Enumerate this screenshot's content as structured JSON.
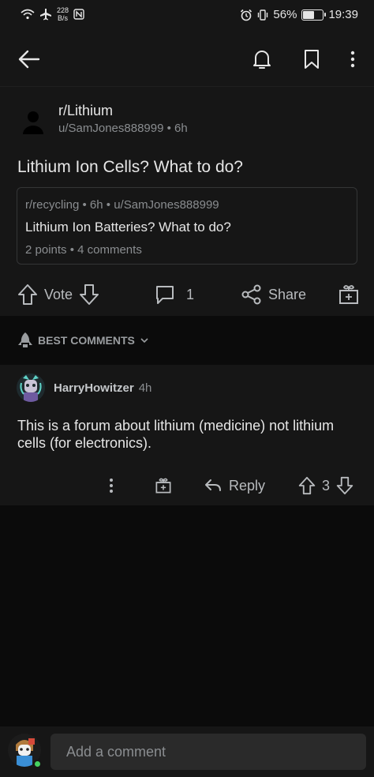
{
  "status_bar": {
    "speed_value": "228",
    "speed_unit": "B/s",
    "battery": "56%",
    "battery_level": 0.56,
    "time": "19:39"
  },
  "post": {
    "subreddit": "r/Lithium",
    "meta": "u/SamJones888999 • 6h",
    "title": "Lithium Ion Cells? What to do?",
    "crosspost": {
      "meta": "r/recycling • 6h • u/SamJones888999",
      "title": "Lithium Ion Batteries? What to do?",
      "stats": "2 points • 4 comments"
    },
    "actions": {
      "vote_label": "Vote",
      "comment_count": "1",
      "share_label": "Share"
    }
  },
  "sort": {
    "label": "BEST COMMENTS"
  },
  "comments": [
    {
      "author": "HarryHowitzer",
      "time": "4h",
      "body": "This is a forum about lithium (medicine) not lithium cells (for electronics).",
      "reply_label": "Reply",
      "score": "3"
    }
  ],
  "composer": {
    "placeholder": "Add a comment"
  },
  "colors": {
    "background": "#0b0b0b",
    "surface": "#161616",
    "text": "#e6e6e6",
    "muted": "#8a8d90",
    "online": "#46d160"
  },
  "icons": [
    "wifi-icon",
    "airplane-icon",
    "nfc-icon",
    "alarm-icon",
    "vibrate-icon",
    "battery-icon",
    "back-arrow-icon",
    "bell-icon",
    "bookmark-icon",
    "more-vertical-icon",
    "upvote-icon",
    "downvote-icon",
    "comment-icon",
    "share-icon",
    "gift-icon",
    "rocket-icon",
    "chevron-down-icon",
    "reply-icon"
  ]
}
